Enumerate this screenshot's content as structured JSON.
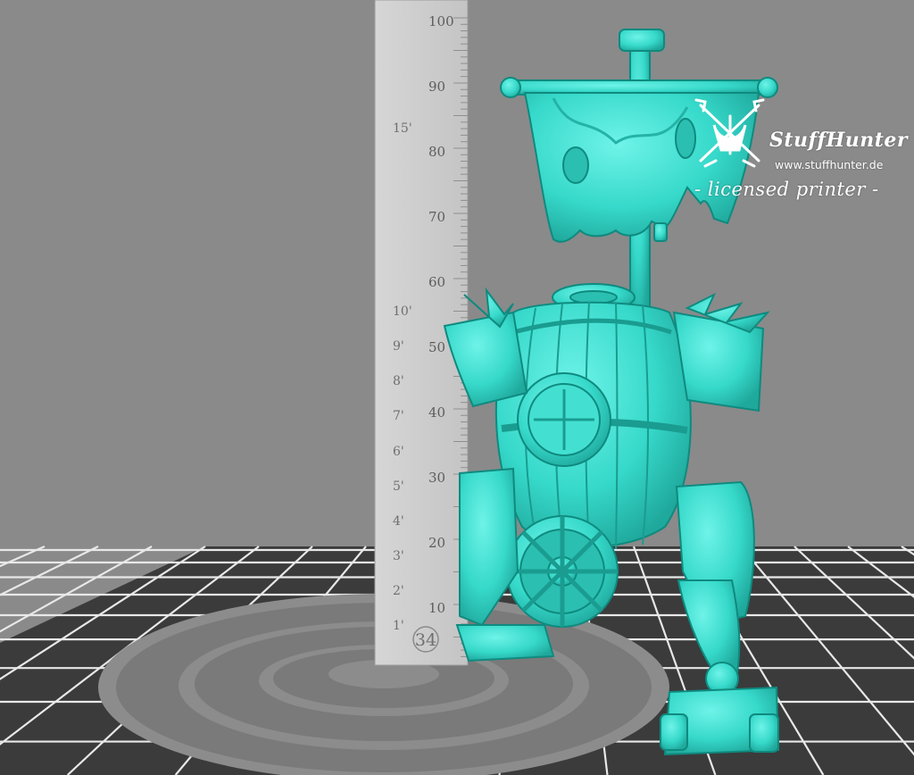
{
  "viewport": {
    "background_color": "#8a8a8a",
    "bed_color": "#3a3a3a",
    "model_color": "#3ce3d4"
  },
  "ruler": {
    "metric_labels": [
      "10",
      "20",
      "30",
      "40",
      "50",
      "60",
      "70",
      "80",
      "90",
      "100"
    ],
    "imperial_labels": [
      "1'",
      "2'",
      "3'",
      "4'",
      "5'",
      "6'",
      "7'",
      "8'",
      "9'",
      "10'",
      "15'"
    ],
    "base_badge": "34"
  },
  "watermark": {
    "title": "StuffHunter",
    "url": "www.stuffhunter.de",
    "subtitle": "- licensed printer -"
  }
}
